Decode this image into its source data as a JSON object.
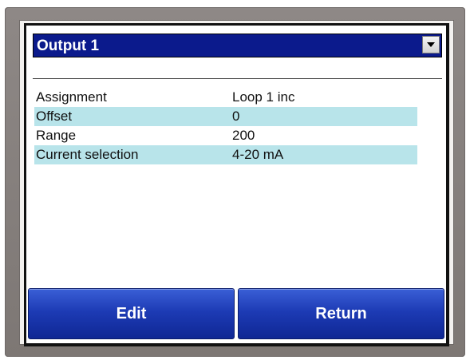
{
  "dropdown": {
    "selected": "Output 1"
  },
  "settings": [
    {
      "label": "Assignment",
      "value": "Loop 1 inc"
    },
    {
      "label": "Offset",
      "value": "0"
    },
    {
      "label": "Range",
      "value": "200"
    },
    {
      "label": "Current selection",
      "value": "4-20 mA"
    }
  ],
  "buttons": {
    "edit": "Edit",
    "return": "Return"
  },
  "colors": {
    "header_blue": "#0b1a8c",
    "row_shade": "#b8e4ea",
    "button_blue": "#1d3bb5"
  }
}
